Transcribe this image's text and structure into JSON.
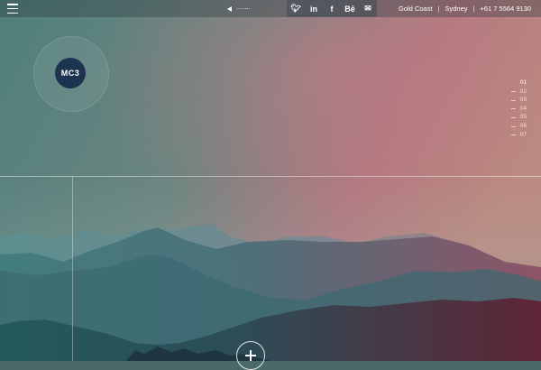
{
  "colors": {
    "sky_left": "#4f7e7a",
    "sky_right": "#b27e80",
    "logo_bg": "#1d3450",
    "mountain_near_left": "#1d4b52",
    "mountain_near_right": "#6a2436"
  },
  "header": {
    "menu_icon": "hamburger-icon",
    "player_prev_icon": "prev-arrow-icon",
    "player_track": "........",
    "social": [
      {
        "icon": "twitter-icon",
        "glyph": "🐦︎"
      },
      {
        "icon": "linkedin-icon",
        "glyph": "in"
      },
      {
        "icon": "facebook-icon",
        "glyph": "f"
      },
      {
        "icon": "behance-icon",
        "glyph": "Bē"
      },
      {
        "icon": "mail-icon",
        "glyph": "✉"
      }
    ],
    "location_1": "Gold Coast",
    "separator": "|",
    "location_2": "Sydney",
    "phone": "+61 7 5564 9130"
  },
  "logo": {
    "text": "MC3"
  },
  "slide_nav": {
    "items": [
      "01",
      "02",
      "03",
      "04",
      "05",
      "06",
      "07"
    ],
    "active_index": 0
  },
  "hero": {
    "add_icon": "plus-icon"
  }
}
